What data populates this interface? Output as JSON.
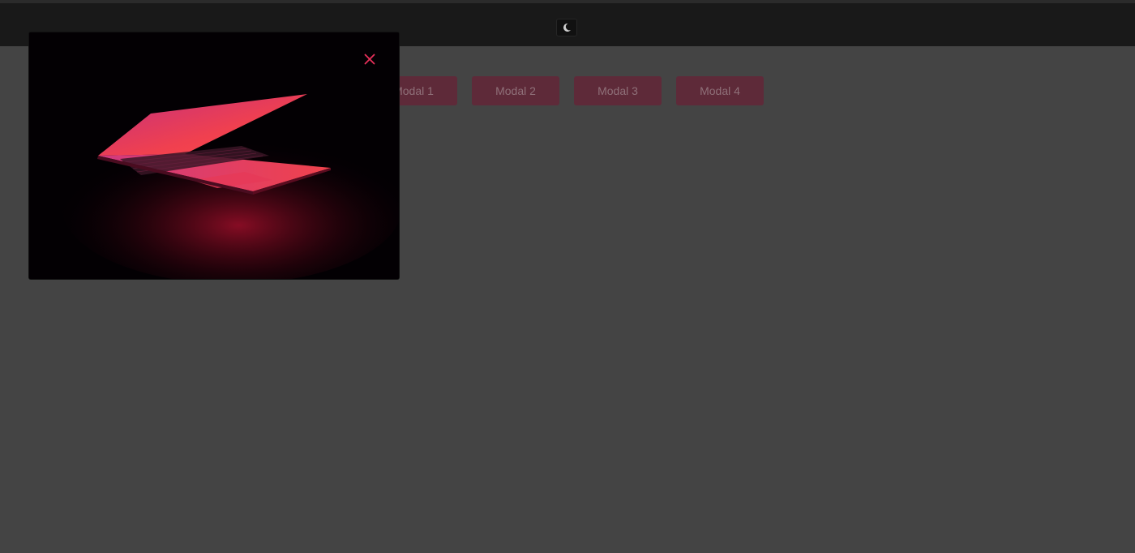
{
  "header": {
    "theme_toggle_icon": "moon-icon"
  },
  "buttons": [
    {
      "label": "Modal 1"
    },
    {
      "label": "Modal 2"
    },
    {
      "label": "Modal 3"
    },
    {
      "label": "Modal 4"
    }
  ],
  "modal": {
    "image_subject": "laptop-glowing-red",
    "close_icon": "close-icon",
    "accent_color": "#e8305a"
  },
  "colors": {
    "overlay_background": "#444444",
    "topbar": "#191919",
    "button_background": "#5e2a39",
    "button_text": "#8f7079"
  }
}
